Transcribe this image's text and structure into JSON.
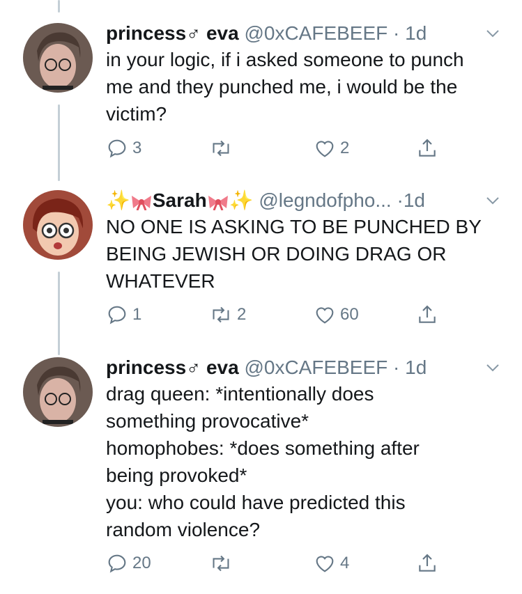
{
  "tweets": [
    {
      "name": "princess♂ eva",
      "handle": "@0xCAFEBEEF",
      "separator": "·",
      "time": "1d",
      "text": "in your logic, if i asked someone to punch\nme and they punched me, i would be the\nvictim?",
      "replies": "3",
      "retweets": "",
      "likes": "2"
    },
    {
      "name": "Sarah",
      "handle": "@legndofpho...",
      "separator": "·",
      "time": "1d",
      "text": "NO ONE IS ASKING TO BE PUNCHED BY\nBEING JEWISH OR DOING DRAG OR\nWHATEVER",
      "replies": "1",
      "retweets": "2",
      "likes": "60"
    },
    {
      "name": "princess♂ eva",
      "handle": "@0xCAFEBEEF",
      "separator": "·",
      "time": "1d",
      "text": "drag queen: *intentionally does\nsomething provocative*\nhomophobes: *does something after\nbeing provoked*\nyou: who could have predicted this\nrandom violence?",
      "replies": "20",
      "retweets": "",
      "likes": "4"
    }
  ],
  "colors": {
    "text": "#14171a",
    "secondary": "#657786",
    "thread": "#c4cfd6"
  },
  "icons": [
    "reply-icon",
    "retweet-icon",
    "like-icon",
    "share-icon",
    "chevron-down-icon",
    "sparkles-icon",
    "ribbon-icon"
  ]
}
